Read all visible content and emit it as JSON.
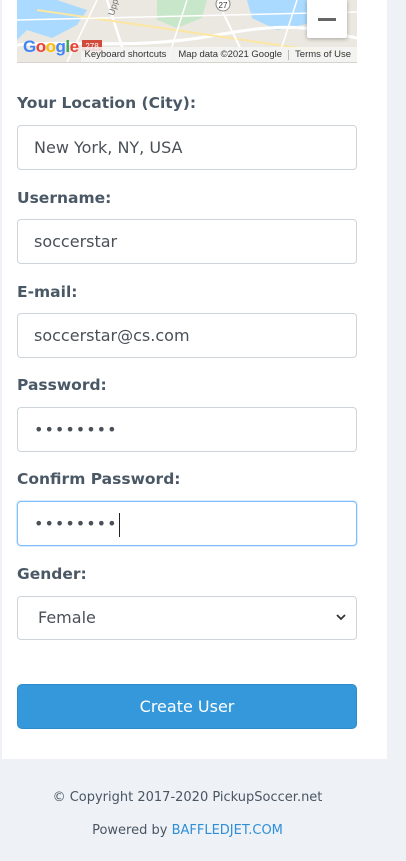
{
  "map": {
    "keyboard_shortcuts": "Keyboard shortcuts",
    "map_data": "Map data ©2021 Google",
    "terms": "Terms of Use",
    "logo_text": "Google",
    "route_labels": [
      "27",
      "278"
    ],
    "place_label": "Upp"
  },
  "form": {
    "location": {
      "label": "Your Location (City):",
      "value": "New York, NY, USA"
    },
    "username": {
      "label": "Username:",
      "value": "soccerstar"
    },
    "email": {
      "label": "E-mail:",
      "value": "soccerstar@cs.com"
    },
    "password": {
      "label": "Password:",
      "value": "••••••••"
    },
    "confirm_password": {
      "label": "Confirm Password:",
      "value": "••••••••"
    },
    "gender": {
      "label": "Gender:",
      "value": "Female"
    },
    "submit_label": "Create User"
  },
  "footer": {
    "copyright": "© Copyright 2017-2020 PickupSoccer.net",
    "powered_prefix": "Powered by ",
    "powered_link": "BAFFLEDJET.COM"
  },
  "colors": {
    "primary_button": "#3498db",
    "link": "#2f8ed8",
    "focus_border": "#80bdff"
  }
}
